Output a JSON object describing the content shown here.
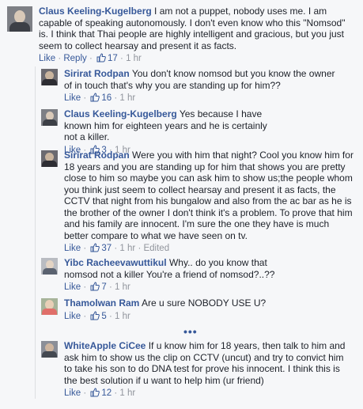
{
  "comments": [
    {
      "author": "Claus Keeling-Kugelberg",
      "text": "I am not a puppet, nobody uses me. I am capable of speaking autonomously. I don't even know who this \"Nomsod\" is. I think that Thai people are highly intelligent and gracious, but you just seem to collect hearsay and present it as facts.",
      "like_label": "Like",
      "reply_label": "Reply",
      "likes": "17",
      "time": "1 hr",
      "edited": ""
    },
    {
      "author": "Sirirat Rodpan",
      "text": "You don't know nomsod but you know the owner of in touch that's why you are standing up for him??",
      "like_label": "Like",
      "likes": "16",
      "time": "1 hr",
      "edited": ""
    },
    {
      "author": "Claus Keeling-Kugelberg",
      "text": "Yes because I have known him for eighteen years and he is certainly not a killer.",
      "like_label": "Like",
      "likes": "3",
      "time": "1 hr",
      "edited": ""
    },
    {
      "author": "Sirirat Rodpan",
      "text": "Were you with him that night? Cool you know him for 18 years and you are standing up for him that shows you are pretty close to him so maybe you can ask him to show us;the people whom you think just seem to collect hearsay and present it as facts, the CCTV that night from his bungalow and also from the ac bar as he is the brother of the owner I don't think it's a problem. To prove that him and his family are innocent. I'm sure the one they have is much better compare to what we have seen on tv.",
      "like_label": "Like",
      "likes": "37",
      "time": "1 hr",
      "edited": "Edited"
    },
    {
      "author": "Yibc Racheevawuttikul",
      "text": "Why.. do you know that nomsod not a killer You're a friend of nomsod?..??",
      "like_label": "Like",
      "likes": "7",
      "time": "1 hr",
      "edited": ""
    },
    {
      "author": "Thamolwan Ram",
      "text": "Are u sure NOBODY USE U?",
      "like_label": "Like",
      "likes": "5",
      "time": "1 hr",
      "edited": ""
    },
    {
      "author": "WhiteApple CiCee",
      "text": "If u know him for 18 years, then talk to him and ask him to show us the clip on CCTV (uncut) and try to convict him to take his son to do DNA test for prove his innocent. I think this is the best solution if u want to help him (ur friend)",
      "like_label": "Like",
      "likes": "12",
      "time": "1 hr",
      "edited": ""
    }
  ],
  "more_replies": "•••",
  "colors": {
    "link": "#365899",
    "text": "#1d2129",
    "meta": "#90949c",
    "background": "#f6f7f9"
  },
  "icons": {
    "like": "thumbs-up-icon"
  }
}
